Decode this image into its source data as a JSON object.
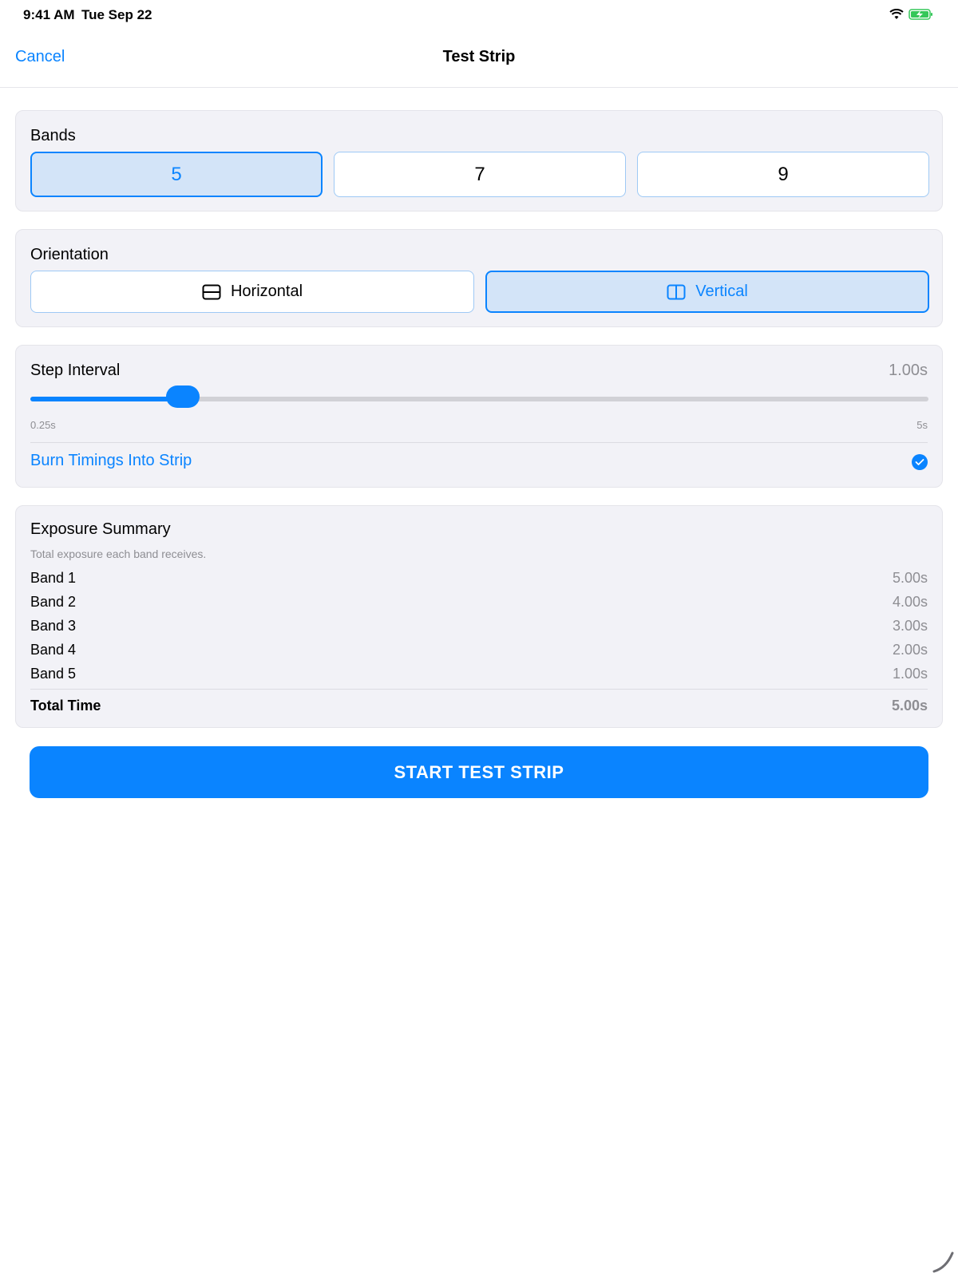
{
  "status": {
    "time": "9:41 AM",
    "date": "Tue Sep 22"
  },
  "nav": {
    "cancel": "Cancel",
    "title": "Test Strip"
  },
  "bands": {
    "label": "Bands",
    "options": [
      "5",
      "7",
      "9"
    ],
    "selected": "5"
  },
  "orientation": {
    "label": "Orientation",
    "options": [
      {
        "label": "Horizontal",
        "icon": "horizontal-split-icon"
      },
      {
        "label": "Vertical",
        "icon": "vertical-split-icon"
      }
    ],
    "selected": "Vertical"
  },
  "step_interval": {
    "label": "Step Interval",
    "value": "1.00s",
    "min_label": "0.25s",
    "max_label": "5s",
    "slider_fraction": 0.17
  },
  "burn_timings": {
    "label": "Burn Timings Into Strip",
    "checked": true
  },
  "summary": {
    "title": "Exposure Summary",
    "subtitle": "Total exposure each band receives.",
    "bands": [
      {
        "name": "Band 1",
        "value": "5.00s"
      },
      {
        "name": "Band 2",
        "value": "4.00s"
      },
      {
        "name": "Band 3",
        "value": "3.00s"
      },
      {
        "name": "Band 4",
        "value": "2.00s"
      },
      {
        "name": "Band 5",
        "value": "1.00s"
      }
    ],
    "total_label": "Total Time",
    "total_value": "5.00s"
  },
  "start_button": "START TEST STRIP",
  "colors": {
    "accent": "#0a84ff",
    "card_bg": "#f2f2f7",
    "selected_bg": "#d3e4f8",
    "secondary_text": "#8e8e93"
  }
}
